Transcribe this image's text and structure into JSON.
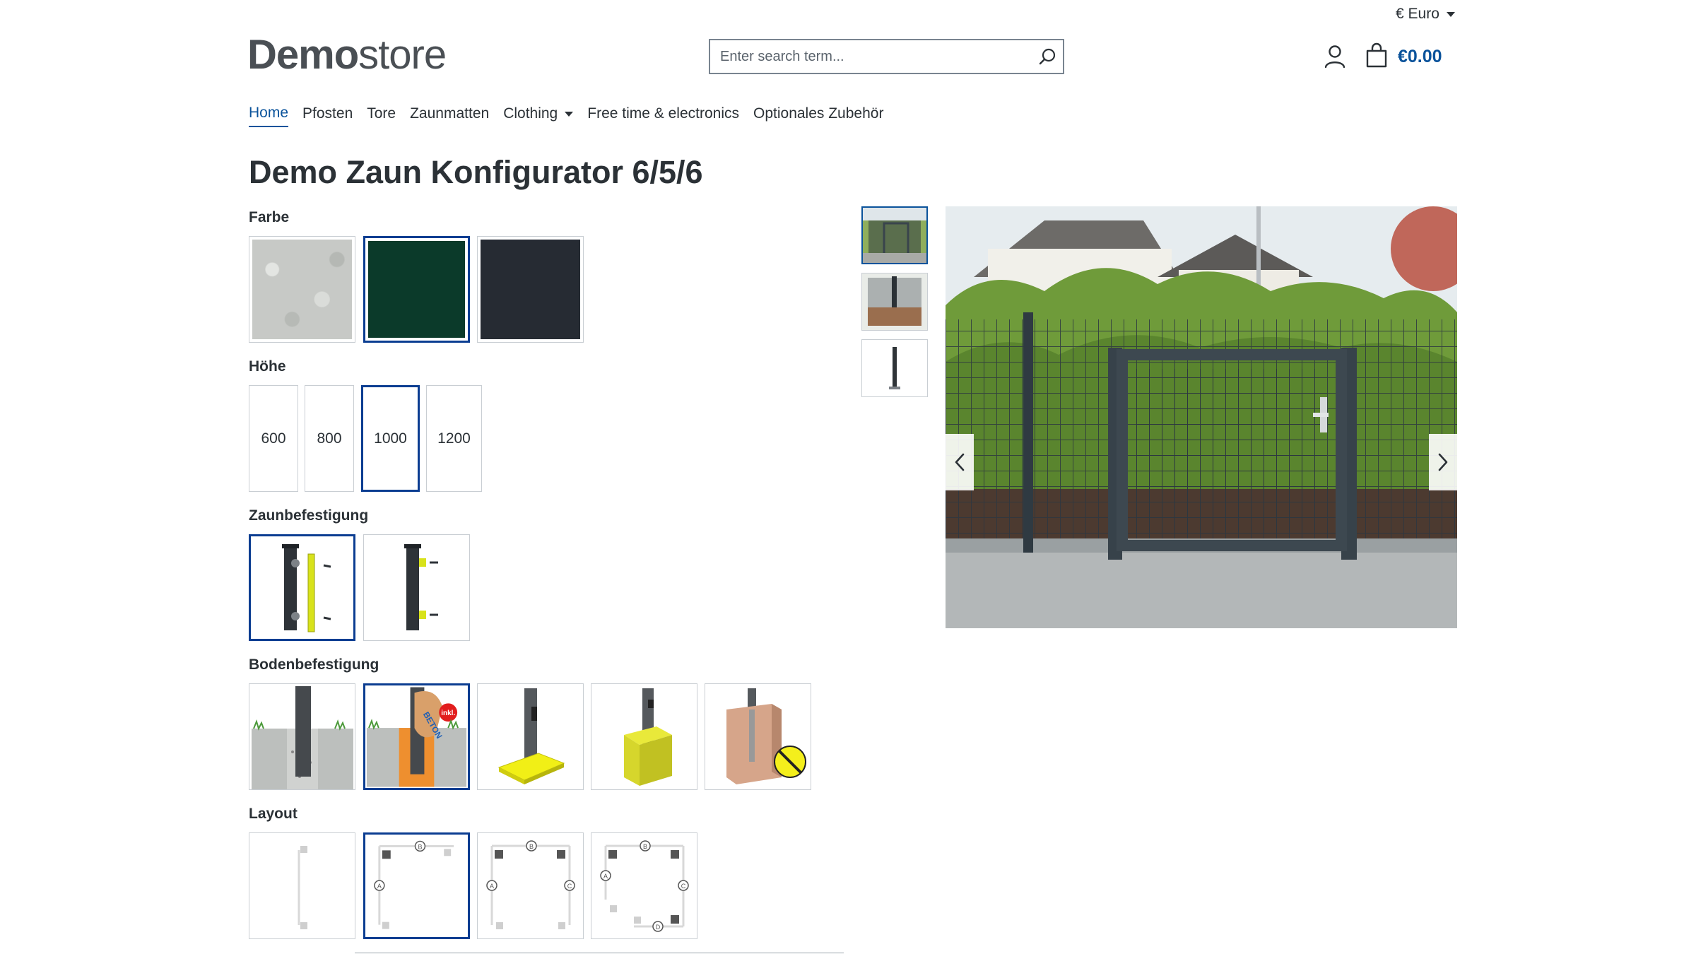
{
  "header": {
    "currency": "€ Euro",
    "logo_bold": "Demo",
    "logo_light": "store",
    "search_placeholder": "Enter search term...",
    "cart_total": "€0.00"
  },
  "nav": {
    "items": [
      {
        "label": "Home"
      },
      {
        "label": "Pfosten"
      },
      {
        "label": "Tore"
      },
      {
        "label": "Zaunmatten"
      },
      {
        "label": "Clothing"
      },
      {
        "label": "Free time & electronics"
      },
      {
        "label": "Optionales Zubehör"
      }
    ]
  },
  "product": {
    "title": "Demo Zaun Konfigurator 6/5/6"
  },
  "config": {
    "farbe_label": "Farbe",
    "farbe_colors": [
      "#c7c9c6",
      "#0b3a2a",
      "#262b33"
    ],
    "hoehe_label": "Höhe",
    "hoehe_options": [
      "600",
      "800",
      "1000",
      "1200"
    ],
    "zaun_label": "Zaunbefestigung",
    "boden_label": "Bodenbefestigung",
    "boden_badge": "inkl.",
    "boden_beton": "BETON",
    "layout_label": "Layout",
    "marker_a": "A",
    "marker_b": "B",
    "marker_c": "C",
    "marker_d": "D"
  },
  "colors": {
    "accent": "#0b539b",
    "selected_border": "#0b3d91"
  }
}
